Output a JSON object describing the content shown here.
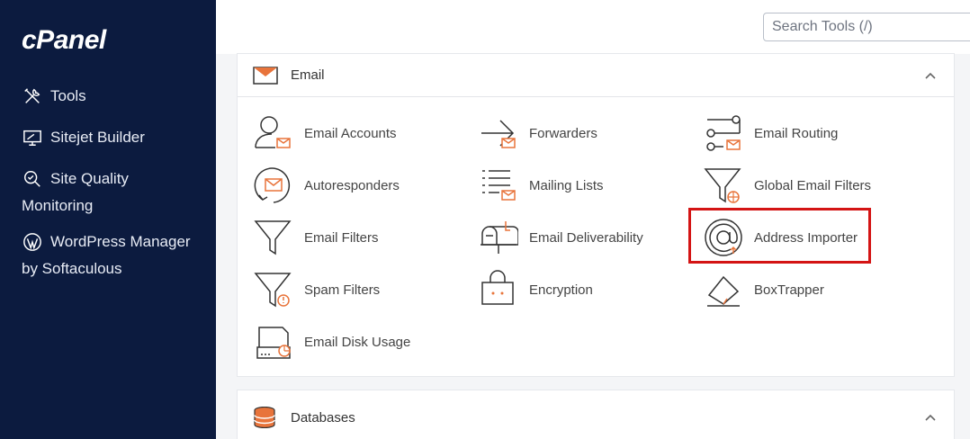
{
  "brand": {
    "logo_text": "cPanel"
  },
  "sidebar": {
    "items": [
      {
        "label": "Tools",
        "icon": "tools-icon"
      },
      {
        "label": "Sitejet Builder",
        "icon": "monitor-icon"
      },
      {
        "label": "Site Quality",
        "label2": "Monitoring",
        "icon": "magnifier-check-icon"
      },
      {
        "label": "WordPress Manager",
        "label2": "by Softaculous",
        "icon": "wordpress-icon"
      }
    ]
  },
  "search": {
    "placeholder": "Search Tools (/)",
    "value": ""
  },
  "email_section": {
    "title": "Email",
    "tools": [
      {
        "label": "Email Accounts",
        "icon": "email-accounts-icon"
      },
      {
        "label": "Forwarders",
        "icon": "forwarders-icon"
      },
      {
        "label": "Email Routing",
        "icon": "email-routing-icon"
      },
      {
        "label": "Autoresponders",
        "icon": "autoresponders-icon"
      },
      {
        "label": "Mailing Lists",
        "icon": "mailing-lists-icon"
      },
      {
        "label": "Global Email Filters",
        "icon": "global-email-filters-icon"
      },
      {
        "label": "Email Filters",
        "icon": "email-filters-icon"
      },
      {
        "label": "Email Deliverability",
        "icon": "email-deliverability-icon"
      },
      {
        "label": "Address Importer",
        "icon": "address-importer-icon"
      },
      {
        "label": "Spam Filters",
        "icon": "spam-filters-icon"
      },
      {
        "label": "Encryption",
        "icon": "encryption-icon"
      },
      {
        "label": "BoxTrapper",
        "icon": "boxtrapper-icon"
      },
      {
        "label": "Email Disk Usage",
        "icon": "email-disk-usage-icon"
      }
    ]
  },
  "databases_section": {
    "title": "Databases"
  },
  "colors": {
    "sidebar_bg": "#0c1b3f",
    "accent_orange": "#e8743b",
    "highlight_red": "#d41414"
  }
}
